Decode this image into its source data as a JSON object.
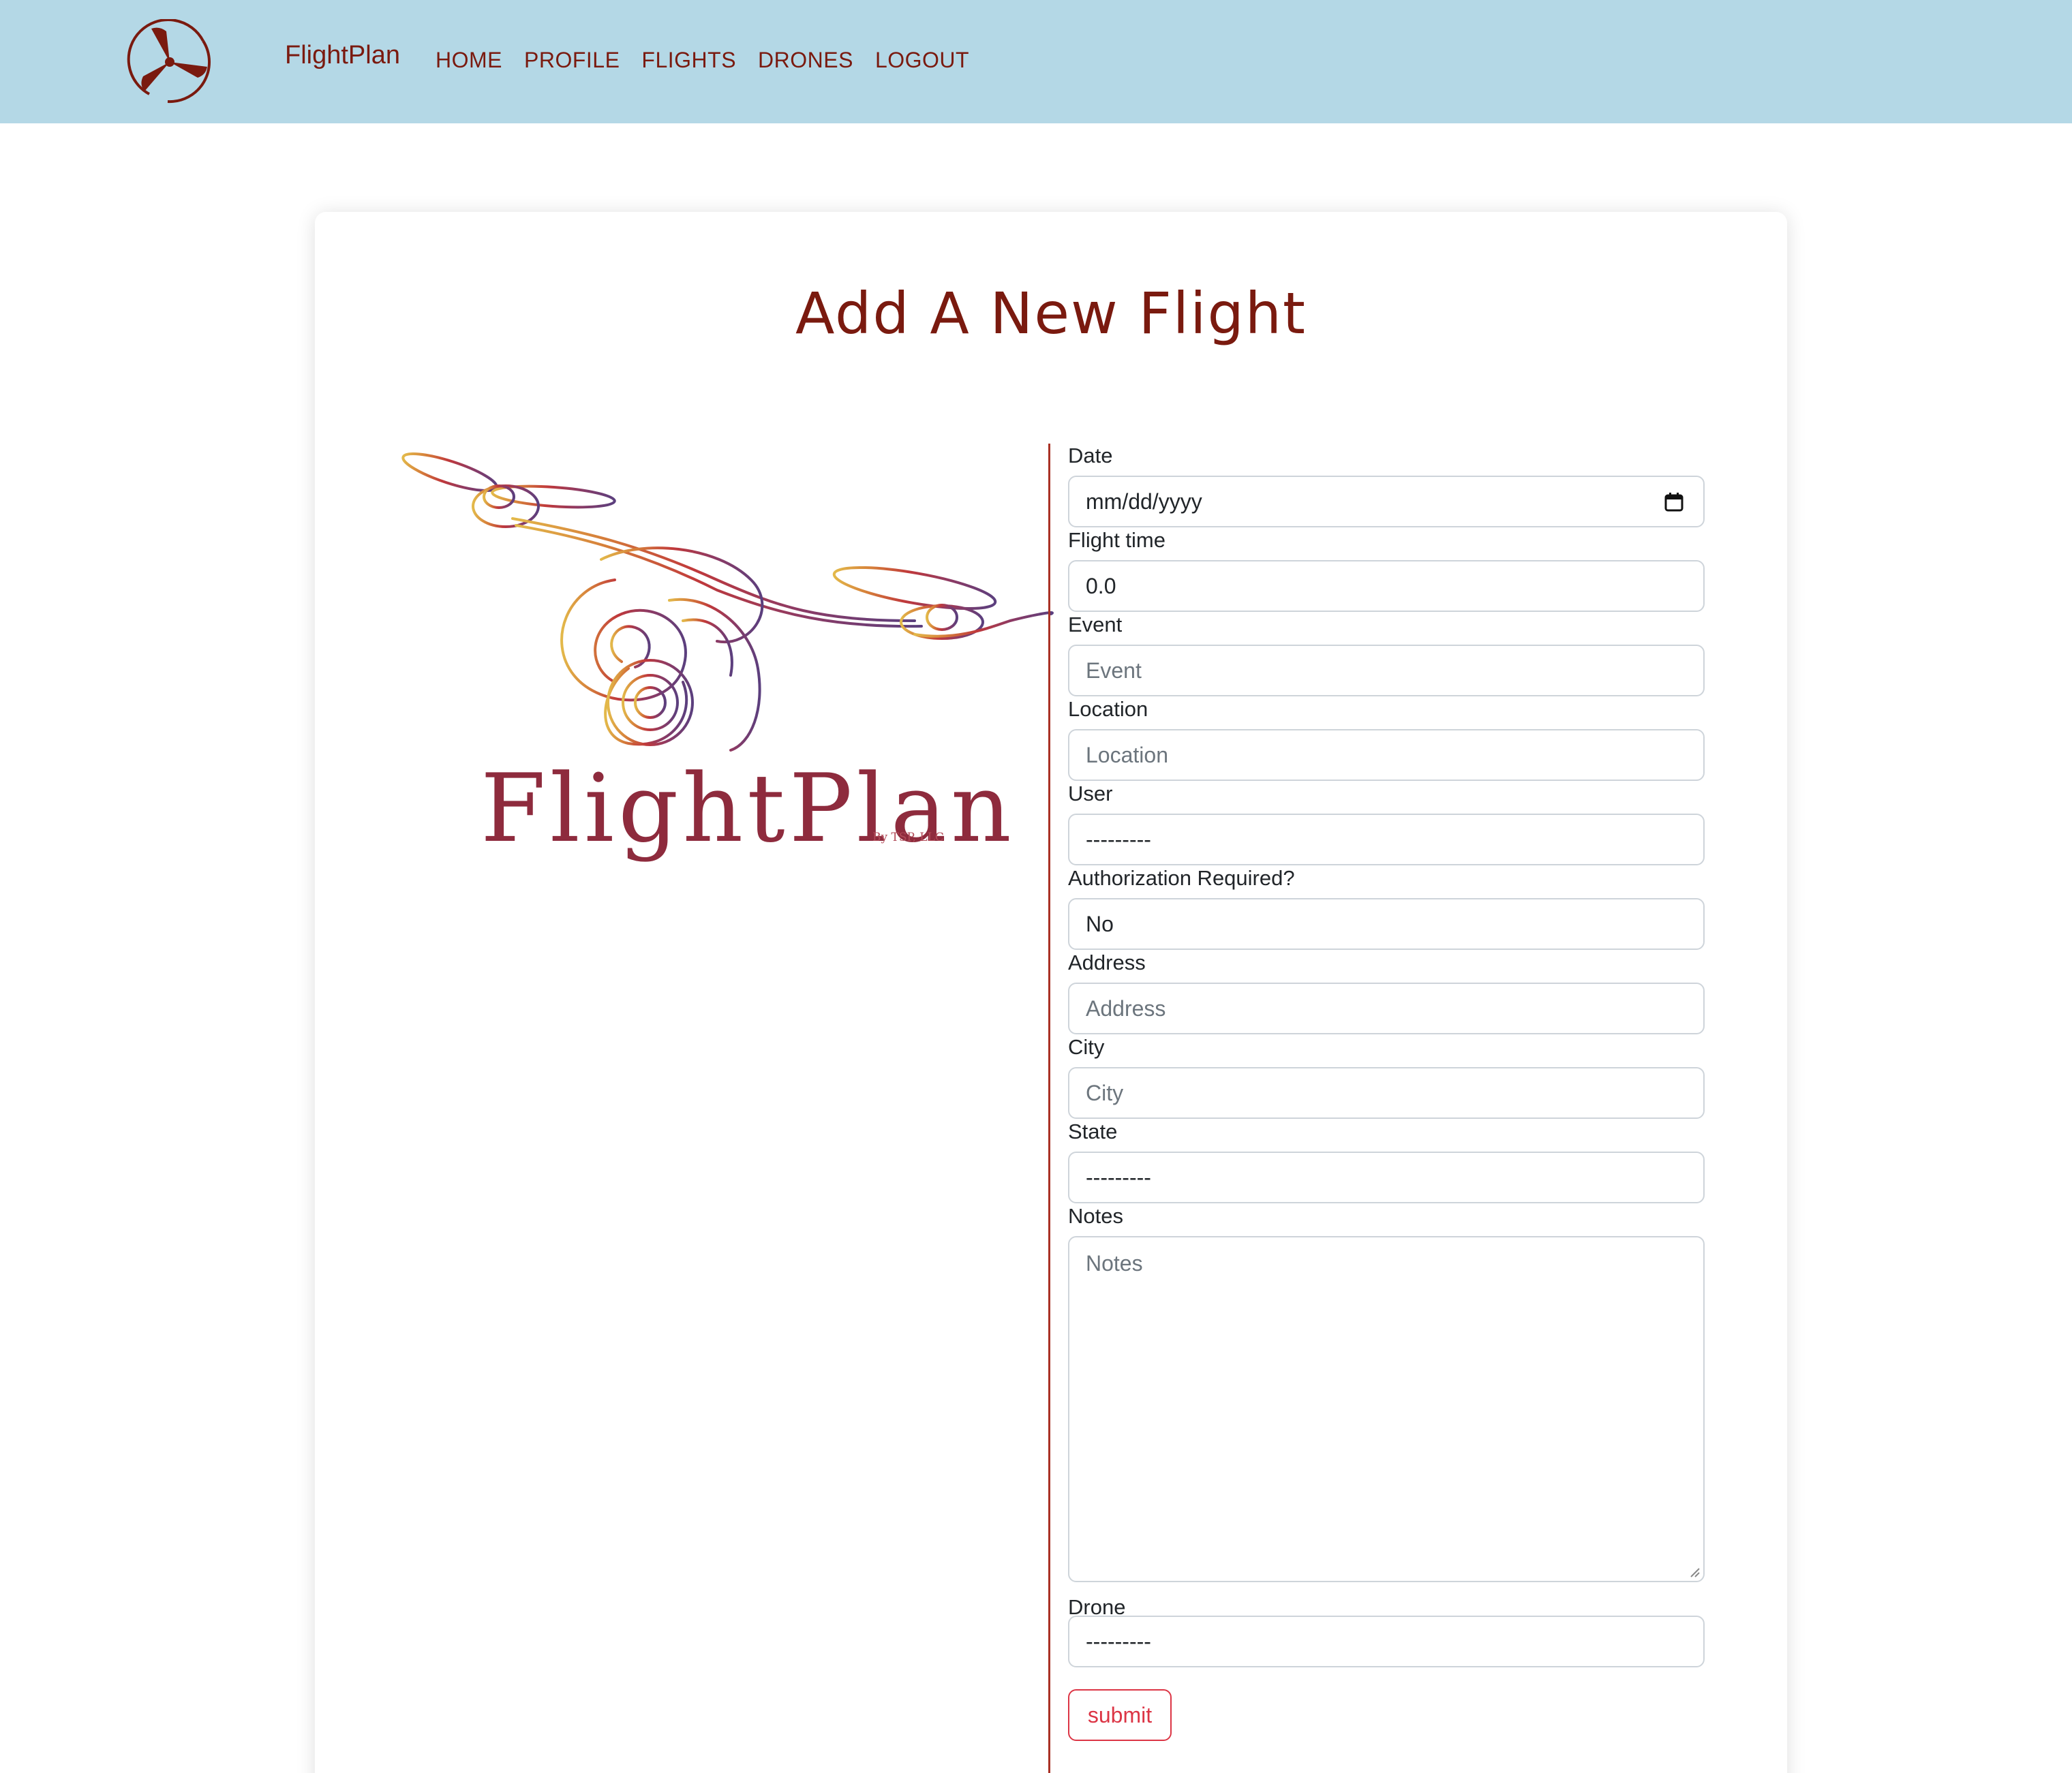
{
  "nav": {
    "logo_icon": "propeller-icon",
    "brand": "FlightPlan",
    "links": [
      "HOME",
      "PROFILE",
      "FLIGHTS",
      "DRONES",
      "LOGOUT"
    ]
  },
  "page": {
    "title": "Add A New Flight"
  },
  "logo": {
    "wordmark": "FlightPlan",
    "byline": "By TSP, LLC",
    "icon": "drone-line-art"
  },
  "form": {
    "date": {
      "label": "Date",
      "value": "mm/dd/yyyy",
      "icon": "calendar-icon"
    },
    "flight_time": {
      "label": "Flight time",
      "value": "0.0"
    },
    "event": {
      "label": "Event",
      "placeholder": "Event"
    },
    "location": {
      "label": "Location",
      "placeholder": "Location"
    },
    "user": {
      "label": "User",
      "value": "---------"
    },
    "authorization": {
      "label": "Authorization Required?",
      "value": "No"
    },
    "address": {
      "label": "Address",
      "placeholder": "Address"
    },
    "city": {
      "label": "City",
      "placeholder": "City"
    },
    "state": {
      "label": "State",
      "value": "---------"
    },
    "notes": {
      "label": "Notes",
      "placeholder": "Notes"
    },
    "drone": {
      "label": "Drone",
      "value": "---------"
    },
    "submit_label": "submit"
  },
  "colors": {
    "navbar_bg": "#b4d8e6",
    "brand": "#7a1a0f",
    "submit": "#dc3545",
    "divider": "#a93226"
  }
}
